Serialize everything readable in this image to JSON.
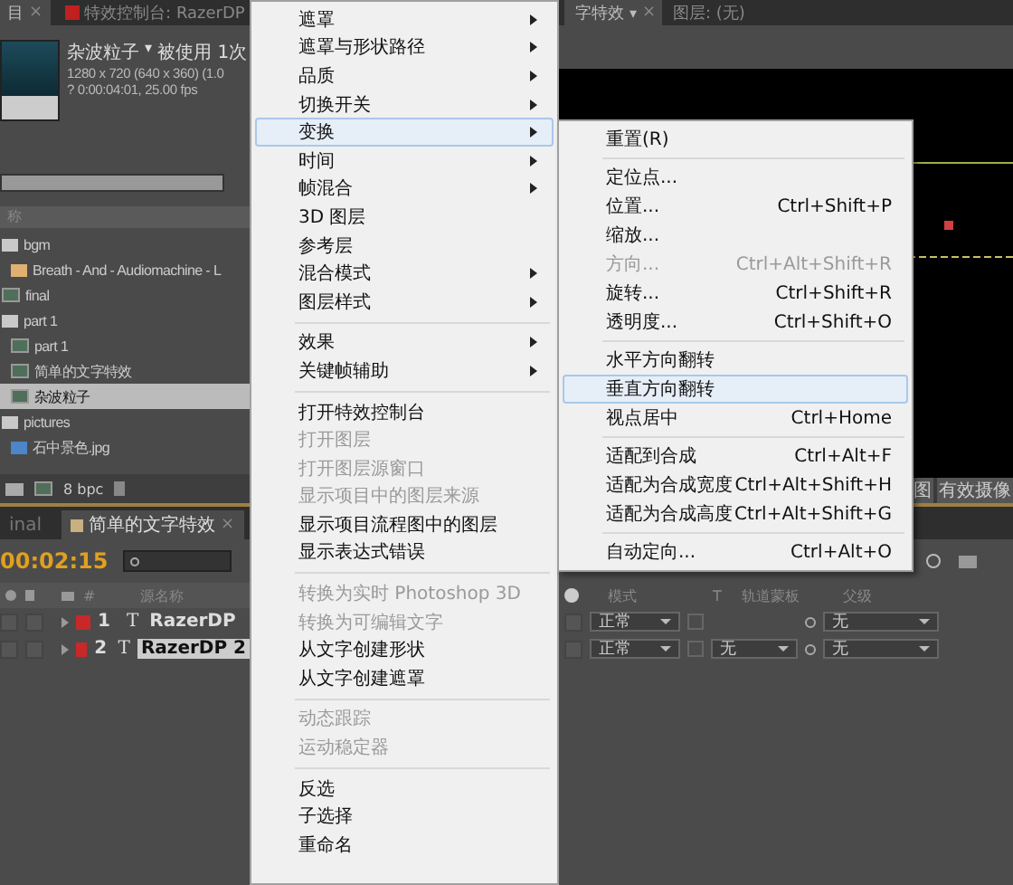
{
  "project_panel": {
    "tabs": [
      {
        "label": "目",
        "close": "×",
        "selected": true
      },
      {
        "label": "特效控制台: RazerDP",
        "selected": false
      }
    ],
    "item_info": {
      "name": "杂波粒子",
      "caret": "▾",
      "usage": "被使用 1次",
      "lines": [
        "1280 x 720 (640 x 360) (1.0",
        "? 0:00:04:01, 25.00 fps"
      ]
    },
    "column_header": "称",
    "items": [
      {
        "kind": "folder",
        "label": "bgm",
        "selected": false,
        "children": [
          {
            "kind": "audio",
            "label": "Breath - And - Audiomachine - L",
            "selected": false
          }
        ]
      },
      {
        "kind": "comp",
        "label": "final",
        "selected": false
      },
      {
        "kind": "folder",
        "label": "part 1",
        "selected": false,
        "children": [
          {
            "kind": "comp",
            "label": "part 1",
            "selected": false
          },
          {
            "kind": "comp",
            "label": "简单的文字特效",
            "selected": false
          },
          {
            "kind": "comp",
            "label": "杂波粒子",
            "selected": true
          }
        ]
      },
      {
        "kind": "folder",
        "label": "pictures",
        "selected": false,
        "children": [
          {
            "kind": "image",
            "label": "石中景色.jpg",
            "selected": false
          }
        ]
      }
    ],
    "footer": "8 bpc"
  },
  "viewer": {
    "tabs": [
      {
        "label": "字特效",
        "caret": "▾",
        "close": "×",
        "selected": true
      },
      {
        "label": "图层: (无)",
        "selected": false
      }
    ],
    "toolbar": [
      "图",
      "有效摄像"
    ]
  },
  "timeline": {
    "tabs": [
      {
        "label": "inal",
        "selected": false
      },
      {
        "label": "简单的文字特效",
        "close": "×",
        "selected": true
      }
    ],
    "timecode": "00:02:15",
    "left_columns": [
      "#",
      "源名称"
    ],
    "right_columns": [
      "模式",
      "T",
      "轨道蒙板",
      "父级"
    ],
    "layers": [
      {
        "number": "1",
        "type_icon": "T",
        "name": "RazerDP",
        "color": "#c82828",
        "selected": false,
        "video": false,
        "locked": false,
        "switch_on": false,
        "preserve_transparency": false,
        "mode": "正常",
        "parent": "无"
      },
      {
        "number": "2",
        "type_icon": "T",
        "name": "RazerDP 2",
        "color": "#c82828",
        "selected": true,
        "video": false,
        "locked": false,
        "switch_on": false,
        "preserve_transparency": false,
        "mode": "正常",
        "track_matte": "无",
        "parent": "无"
      }
    ]
  },
  "context_menu": {
    "items": [
      {
        "kind": "item",
        "label": "遮罩",
        "submenu": true,
        "disabled": false,
        "selected": false
      },
      {
        "kind": "item",
        "label": "遮罩与形状路径",
        "submenu": true,
        "disabled": false,
        "selected": false
      },
      {
        "kind": "item",
        "label": "品质",
        "submenu": true,
        "disabled": false,
        "selected": false
      },
      {
        "kind": "item",
        "label": "切换开关",
        "submenu": true,
        "disabled": false,
        "selected": false
      },
      {
        "kind": "item",
        "label": "变换",
        "submenu": true,
        "disabled": false,
        "selected": true
      },
      {
        "kind": "item",
        "label": "时间",
        "submenu": true,
        "disabled": false,
        "selected": false
      },
      {
        "kind": "item",
        "label": "帧混合",
        "submenu": true,
        "disabled": false,
        "selected": false
      },
      {
        "kind": "item",
        "label": "3D 图层",
        "submenu": false,
        "disabled": false,
        "selected": false
      },
      {
        "kind": "item",
        "label": "参考层",
        "submenu": false,
        "disabled": false,
        "selected": false
      },
      {
        "kind": "item",
        "label": "混合模式",
        "submenu": true,
        "disabled": false,
        "selected": false
      },
      {
        "kind": "item",
        "label": "图层样式",
        "submenu": true,
        "disabled": false,
        "selected": false
      },
      {
        "kind": "separator"
      },
      {
        "kind": "item",
        "label": "效果",
        "submenu": true,
        "disabled": false,
        "selected": false
      },
      {
        "kind": "item",
        "label": "关键帧辅助",
        "submenu": true,
        "disabled": false,
        "selected": false
      },
      {
        "kind": "separator"
      },
      {
        "kind": "item",
        "label": "打开特效控制台",
        "submenu": false,
        "disabled": false,
        "selected": false
      },
      {
        "kind": "item",
        "label": "打开图层",
        "submenu": false,
        "disabled": true,
        "selected": false
      },
      {
        "kind": "item",
        "label": "打开图层源窗口",
        "submenu": false,
        "disabled": true,
        "selected": false
      },
      {
        "kind": "item",
        "label": "显示项目中的图层来源",
        "submenu": false,
        "disabled": true,
        "selected": false
      },
      {
        "kind": "item",
        "label": "显示项目流程图中的图层",
        "submenu": false,
        "disabled": false,
        "selected": false
      },
      {
        "kind": "item",
        "label": "显示表达式错误",
        "submenu": false,
        "disabled": false,
        "selected": false
      },
      {
        "kind": "separator"
      },
      {
        "kind": "item",
        "label": "转换为实时 Photoshop 3D",
        "submenu": false,
        "disabled": true,
        "selected": false
      },
      {
        "kind": "item",
        "label": "转换为可编辑文字",
        "submenu": false,
        "disabled": true,
        "selected": false
      },
      {
        "kind": "item",
        "label": "从文字创建形状",
        "submenu": false,
        "disabled": false,
        "selected": false
      },
      {
        "kind": "item",
        "label": "从文字创建遮罩",
        "submenu": false,
        "disabled": false,
        "selected": false
      },
      {
        "kind": "separator"
      },
      {
        "kind": "item",
        "label": "动态跟踪",
        "submenu": false,
        "disabled": true,
        "selected": false
      },
      {
        "kind": "item",
        "label": "运动稳定器",
        "submenu": false,
        "disabled": true,
        "selected": false
      },
      {
        "kind": "separator"
      },
      {
        "kind": "item",
        "label": "反选",
        "submenu": false,
        "disabled": false,
        "selected": false
      },
      {
        "kind": "item",
        "label": "子选择",
        "submenu": false,
        "disabled": false,
        "selected": false
      },
      {
        "kind": "item",
        "label": "重命名",
        "submenu": false,
        "disabled": false,
        "selected": false
      }
    ]
  },
  "submenu": {
    "items": [
      {
        "kind": "item",
        "label": "重置(R)",
        "disabled": false,
        "selected": false
      },
      {
        "kind": "separator"
      },
      {
        "kind": "item",
        "label": "定位点...",
        "disabled": false,
        "selected": false
      },
      {
        "kind": "item",
        "label": "位置...",
        "shortcut": "Ctrl+Shift+P",
        "disabled": false,
        "selected": false
      },
      {
        "kind": "item",
        "label": "缩放...",
        "disabled": false,
        "selected": false
      },
      {
        "kind": "item",
        "label": "方向...",
        "shortcut": "Ctrl+Alt+Shift+R",
        "disabled": true,
        "selected": false
      },
      {
        "kind": "item",
        "label": "旋转...",
        "shortcut": "Ctrl+Shift+R",
        "disabled": false,
        "selected": false
      },
      {
        "kind": "item",
        "label": "透明度...",
        "shortcut": "Ctrl+Shift+O",
        "disabled": false,
        "selected": false
      },
      {
        "kind": "separator"
      },
      {
        "kind": "item",
        "label": "水平方向翻转",
        "disabled": false,
        "selected": false
      },
      {
        "kind": "item",
        "label": "垂直方向翻转",
        "disabled": false,
        "selected": true
      },
      {
        "kind": "item",
        "label": "视点居中",
        "shortcut": "Ctrl+Home",
        "disabled": false,
        "selected": false
      },
      {
        "kind": "separator"
      },
      {
        "kind": "item",
        "label": "适配到合成",
        "shortcut": "Ctrl+Alt+F",
        "disabled": false,
        "selected": false
      },
      {
        "kind": "item",
        "label": "适配为合成宽度",
        "shortcut": "Ctrl+Alt+Shift+H",
        "disabled": false,
        "selected": false
      },
      {
        "kind": "item",
        "label": "适配为合成高度",
        "shortcut": "Ctrl+Alt+Shift+G",
        "disabled": false,
        "selected": false
      },
      {
        "kind": "separator"
      },
      {
        "kind": "item",
        "label": "自动定向...",
        "shortcut": "Ctrl+Alt+O",
        "disabled": false,
        "selected": false
      }
    ]
  }
}
